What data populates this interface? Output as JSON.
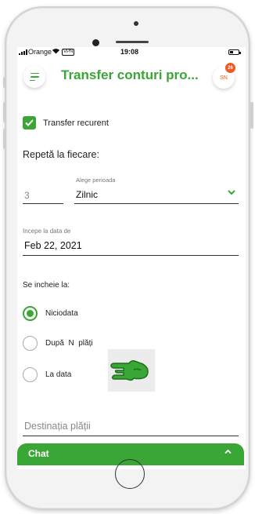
{
  "status_bar": {
    "carrier": "Orange",
    "vpn": "VPN",
    "time": "19:08"
  },
  "header": {
    "title": "Transfer conturi pro...",
    "avatar_initials": "SN",
    "notification_count": "26"
  },
  "form": {
    "recurring_label": "Transfer recurent",
    "recurring_checked": true,
    "repeat_label": "Repetă la fiecare:",
    "interval_value": "3",
    "period_caption": "Alege perioada",
    "period_value": "Zilnic",
    "start_caption": "Incepe la data de",
    "start_value": "Feb 22, 2021",
    "ends_label": "Se incheie la:",
    "end_options": [
      {
        "label": "Niciodata",
        "selected": true
      },
      {
        "label": "După  N  plăți",
        "selected": false
      },
      {
        "label": "La data",
        "selected": false
      }
    ],
    "destination_placeholder": "Destinația plății"
  },
  "chat": {
    "label": "Chat"
  },
  "colors": {
    "accent": "#3aa635",
    "badge": "#ee5a24"
  },
  "icons": {
    "menu": "hamburger-icon",
    "chevron": "chevron-down-icon",
    "chat_toggle": "chevron-up-icon",
    "check": "check-icon",
    "hand": "pointing-hand-icon"
  }
}
